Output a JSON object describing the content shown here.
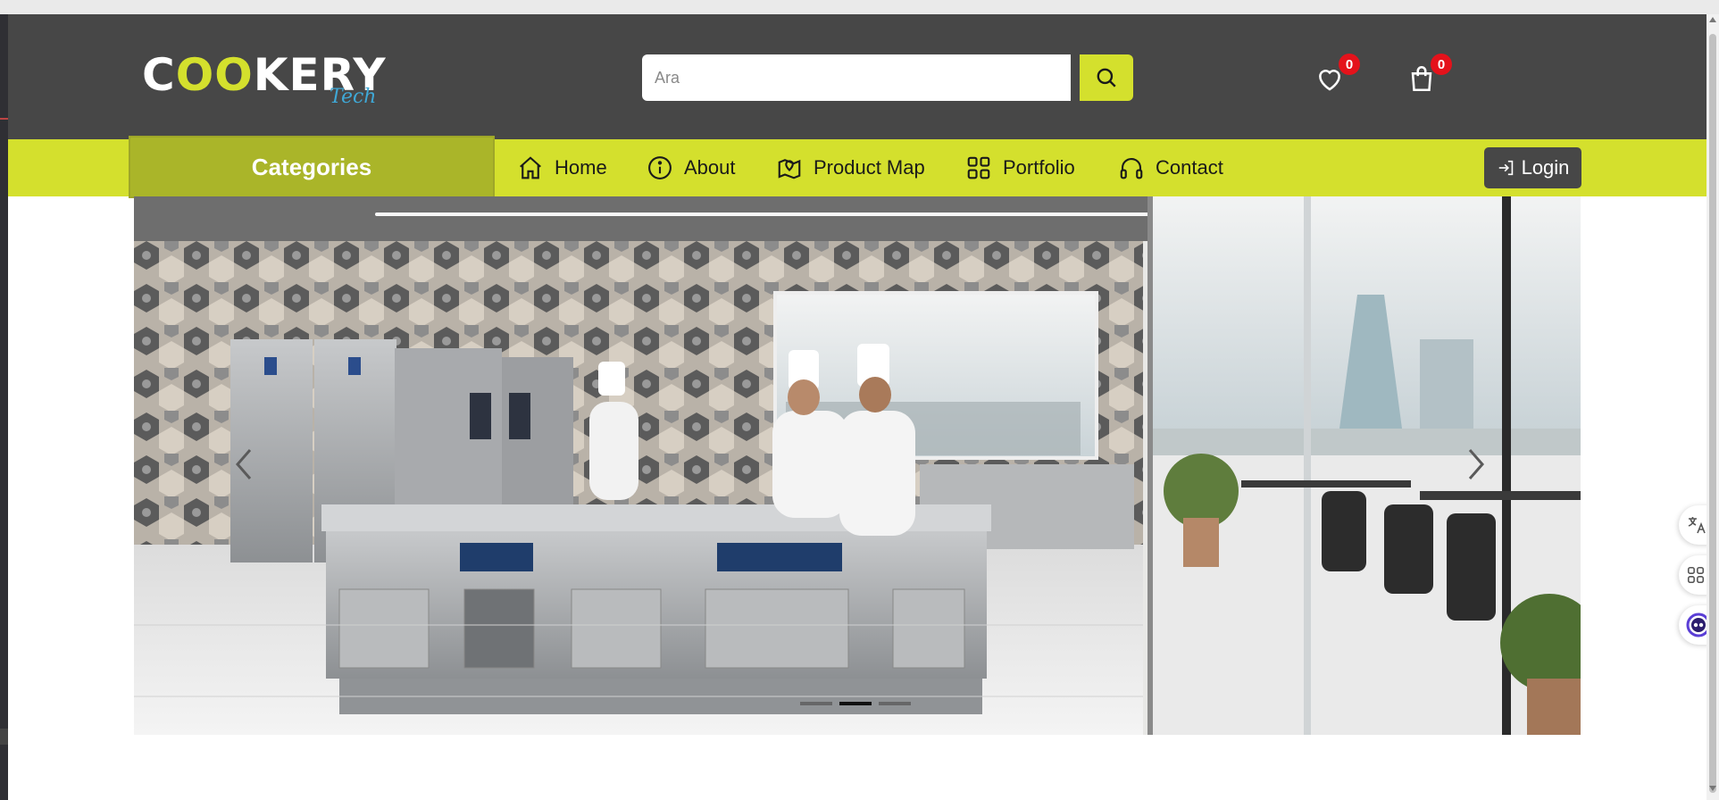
{
  "brand": {
    "logo_prefix": "C",
    "logo_oo": "OO",
    "logo_suffix": "KERY",
    "logo_sub": "Tech",
    "accent": "#d4e02d",
    "header_bg": "#474747"
  },
  "search": {
    "placeholder": "Ara",
    "icon": "search-icon"
  },
  "header": {
    "wishlist": {
      "icon": "heart-icon",
      "count": "0"
    },
    "cart": {
      "icon": "shopping-bag-icon",
      "count": "0"
    }
  },
  "nav": {
    "categories_label": "Categories",
    "items": [
      {
        "label": "Home",
        "icon": "home-icon"
      },
      {
        "label": "About",
        "icon": "info-icon"
      },
      {
        "label": "Product Map",
        "icon": "map-pin-icon"
      },
      {
        "label": "Portfolio",
        "icon": "grid-icon"
      },
      {
        "label": "Contact",
        "icon": "headphones-icon"
      }
    ],
    "login_label": "Login"
  },
  "slider": {
    "image": "Commercial kitchen with chefs",
    "dots": [
      {
        "active": false
      },
      {
        "active": true
      },
      {
        "active": false
      }
    ]
  },
  "floating": [
    {
      "icon": "translate-icon"
    },
    {
      "icon": "apps-icon"
    },
    {
      "icon": "assistant-icon"
    }
  ]
}
